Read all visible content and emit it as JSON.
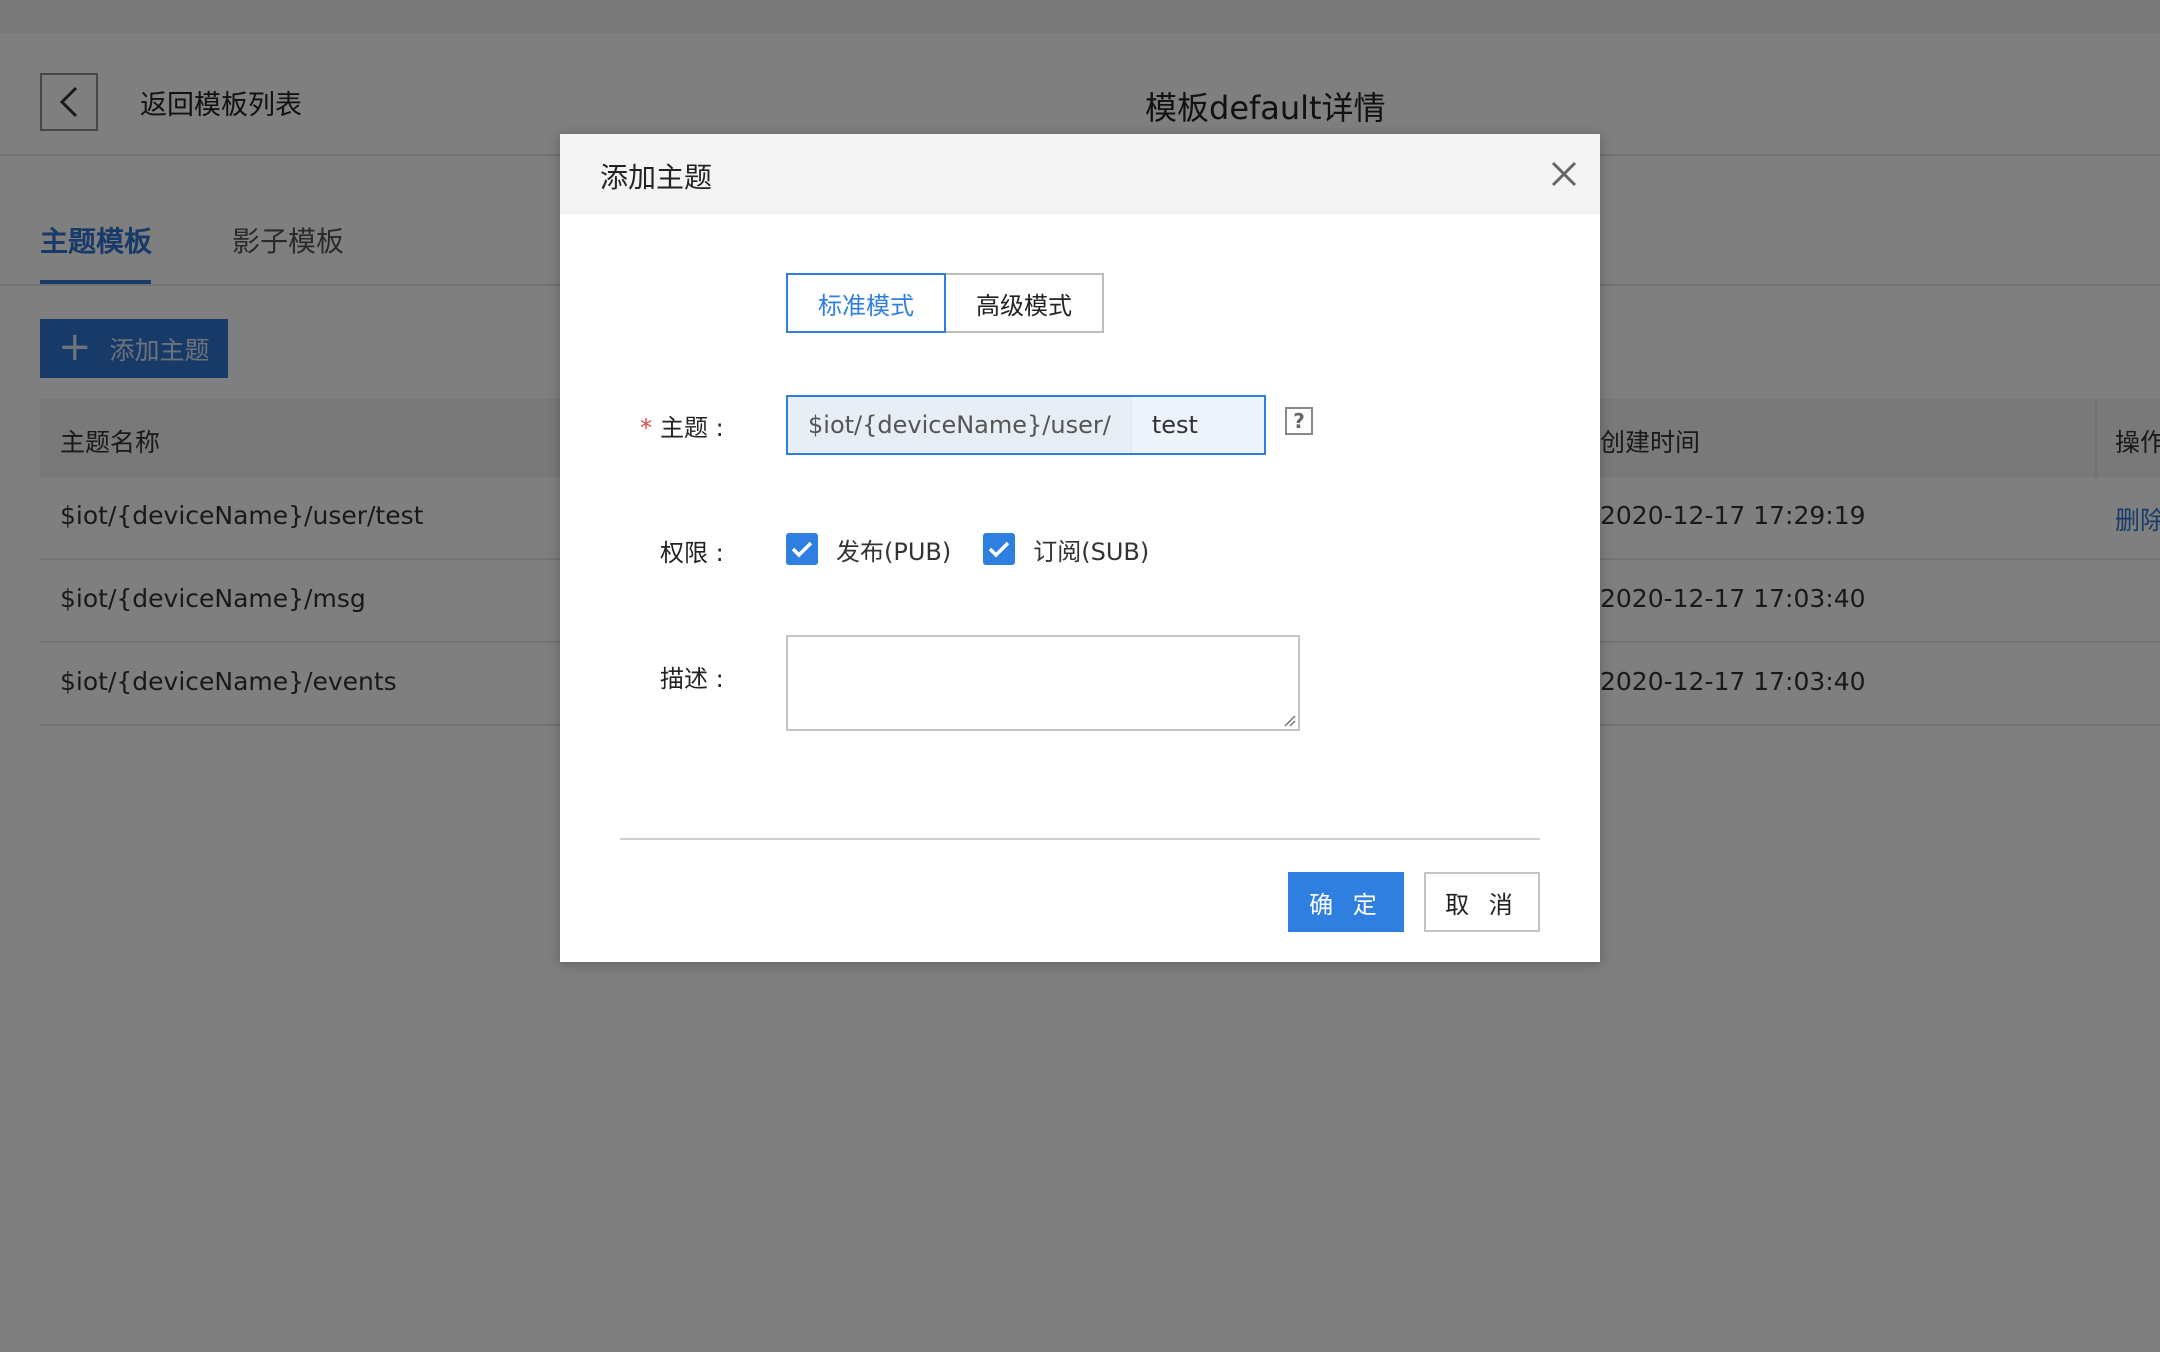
{
  "header": {
    "back_label": "返回模板列表",
    "page_title": "模板default详情"
  },
  "tabs": [
    {
      "label": "主题模板",
      "active": true
    },
    {
      "label": "影子模板",
      "active": false
    }
  ],
  "toolbar": {
    "add_topic_label": "添加主题"
  },
  "table": {
    "columns": {
      "name": "主题名称",
      "created": "创建时间",
      "actions": "操作"
    },
    "rows": [
      {
        "name": "$iot/{deviceName}/user/test",
        "created": "2020-12-17 17:29:19",
        "action": "删除"
      },
      {
        "name": "$iot/{deviceName}/msg",
        "created": "2020-12-17 17:03:40",
        "action": ""
      },
      {
        "name": "$iot/{deviceName}/events",
        "created": "2020-12-17 17:03:40",
        "action": ""
      }
    ]
  },
  "dialog": {
    "title": "添加主题",
    "modes": [
      {
        "label": "标准模式",
        "selected": true
      },
      {
        "label": "高级模式",
        "selected": false
      }
    ],
    "topic_label": "主题 :",
    "topic_prefix": "$iot/{deviceName}/user/",
    "topic_value": "test",
    "permission_label": "权限 :",
    "permissions": [
      {
        "label": "发布(PUB)",
        "checked": true
      },
      {
        "label": "订阅(SUB)",
        "checked": true
      }
    ],
    "description_label": "描述 :",
    "description_value": "",
    "ok_label": "确 定",
    "cancel_label": "取 消"
  },
  "colors": {
    "accent": "#2f7fe0",
    "brand_blue": "#2f74d0",
    "required": "#e04848",
    "overlay": "rgba(0,0,0,0.5)"
  }
}
